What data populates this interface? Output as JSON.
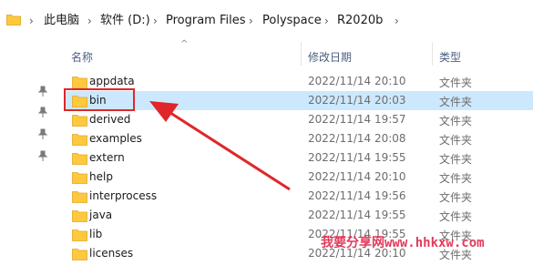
{
  "breadcrumbs": [
    "此电脑",
    "软件 (D:)",
    "Program Files",
    "Polyspace",
    "R2020b"
  ],
  "columns": {
    "name": "名称",
    "modified": "修改日期",
    "type": "类型"
  },
  "rows": [
    {
      "name": "appdata",
      "date": "2022/11/14 20:10",
      "type": "文件夹"
    },
    {
      "name": "bin",
      "date": "2022/11/14 20:03",
      "type": "文件夹"
    },
    {
      "name": "derived",
      "date": "2022/11/14 19:57",
      "type": "文件夹"
    },
    {
      "name": "examples",
      "date": "2022/11/14 20:08",
      "type": "文件夹"
    },
    {
      "name": "extern",
      "date": "2022/11/14 19:55",
      "type": "文件夹"
    },
    {
      "name": "help",
      "date": "2022/11/14 20:10",
      "type": "文件夹"
    },
    {
      "name": "interprocess",
      "date": "2022/11/14 19:56",
      "type": "文件夹"
    },
    {
      "name": "java",
      "date": "2022/11/14 19:55",
      "type": "文件夹"
    },
    {
      "name": "lib",
      "date": "2022/11/14 19:55",
      "type": "文件夹"
    },
    {
      "name": "licenses",
      "date": "2022/11/14 20:10",
      "type": "文件夹"
    }
  ],
  "selected_row": "bin",
  "watermark": "我要分享网www.hhkxw.com",
  "colors": {
    "selection": "#cce8ff",
    "annotation": "#e0262a",
    "folder": "#ffc83d"
  }
}
